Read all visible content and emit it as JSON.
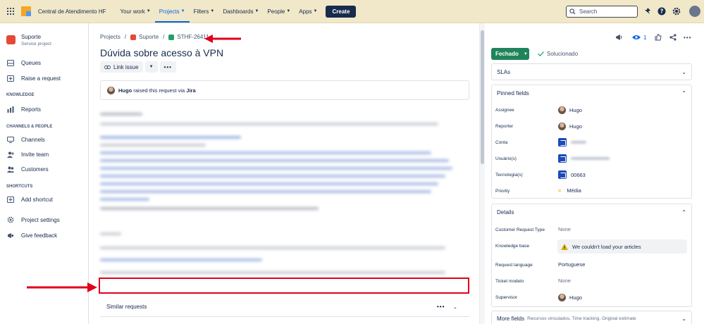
{
  "topbar": {
    "site_name": "Central de Atendimento HF",
    "nav": [
      {
        "label": "Your work"
      },
      {
        "label": "Projects"
      },
      {
        "label": "Filters"
      },
      {
        "label": "Dashboards"
      },
      {
        "label": "People"
      },
      {
        "label": "Apps"
      }
    ],
    "create_label": "Create",
    "search_placeholder": "Search",
    "colors": {
      "bar_bg": "#f1e8c9",
      "active": "#0c66e4"
    }
  },
  "sidebar": {
    "project_name": "Suporte",
    "project_type": "Service project",
    "items_top": [
      {
        "label": "Queues",
        "icon": "queues-icon"
      },
      {
        "label": "Raise a request",
        "icon": "raise-request-icon"
      }
    ],
    "knowledge_heading": "KNOWLEDGE",
    "knowledge_items": [
      {
        "label": "Reports",
        "icon": "reports-icon"
      }
    ],
    "channels_heading": "CHANNELS & PEOPLE",
    "channels_items": [
      {
        "label": "Channels",
        "icon": "channels-icon"
      },
      {
        "label": "Invite team",
        "icon": "invite-team-icon"
      },
      {
        "label": "Customers",
        "icon": "customers-icon"
      }
    ],
    "shortcuts_heading": "SHORTCUTS",
    "shortcuts_items": [
      {
        "label": "Add shortcut",
        "icon": "add-shortcut-icon"
      }
    ],
    "bottom_items": [
      {
        "label": "Project settings",
        "icon": "settings-icon"
      },
      {
        "label": "Give feedback",
        "icon": "feedback-icon"
      }
    ]
  },
  "issue": {
    "breadcrumbs": [
      "Projects",
      "Suporte",
      "STHF-26411"
    ],
    "title": "Dúvida sobre acesso à VPN",
    "link_issue_label": "Link issue",
    "request_author": "Hugo",
    "request_text_mid": " raised this request via ",
    "request_channel": "Jira",
    "similar_requests_label": "Similar requests"
  },
  "right": {
    "watchers_count": "1",
    "status_label": "Fechado",
    "resolution": "Solucionado",
    "slas_label": "SLAs",
    "pinned_label": "Pinned fields",
    "pinned": {
      "assignee_label": "Assignee",
      "assignee": "Hugo",
      "reporter_label": "Reporter",
      "reporter": "Hugo",
      "conta_label": "Conta",
      "usuario_label": "Usuário(s)",
      "tecnologia_label": "Tecnologia(s)",
      "tecnologia": "00663",
      "priority_label": "Priority",
      "priority": "Média"
    },
    "details_label": "Details",
    "details": {
      "customer_request_type_label": "Customer Request Type",
      "customer_request_type": "None",
      "knowledge_base_label": "Knowledge base",
      "knowledge_base_msg": "We couldn't load your articles",
      "request_language_label": "Request language",
      "request_language": "Portuguese",
      "ticket_modelo_label": "Ticket modelo",
      "ticket_modelo": "None",
      "supervisor_label": "Supervisor",
      "supervisor": "Hugo"
    },
    "more_fields_label": "More fields",
    "more_fields_sub": "Recursos vinculados, Time tracking, Original estimate"
  }
}
